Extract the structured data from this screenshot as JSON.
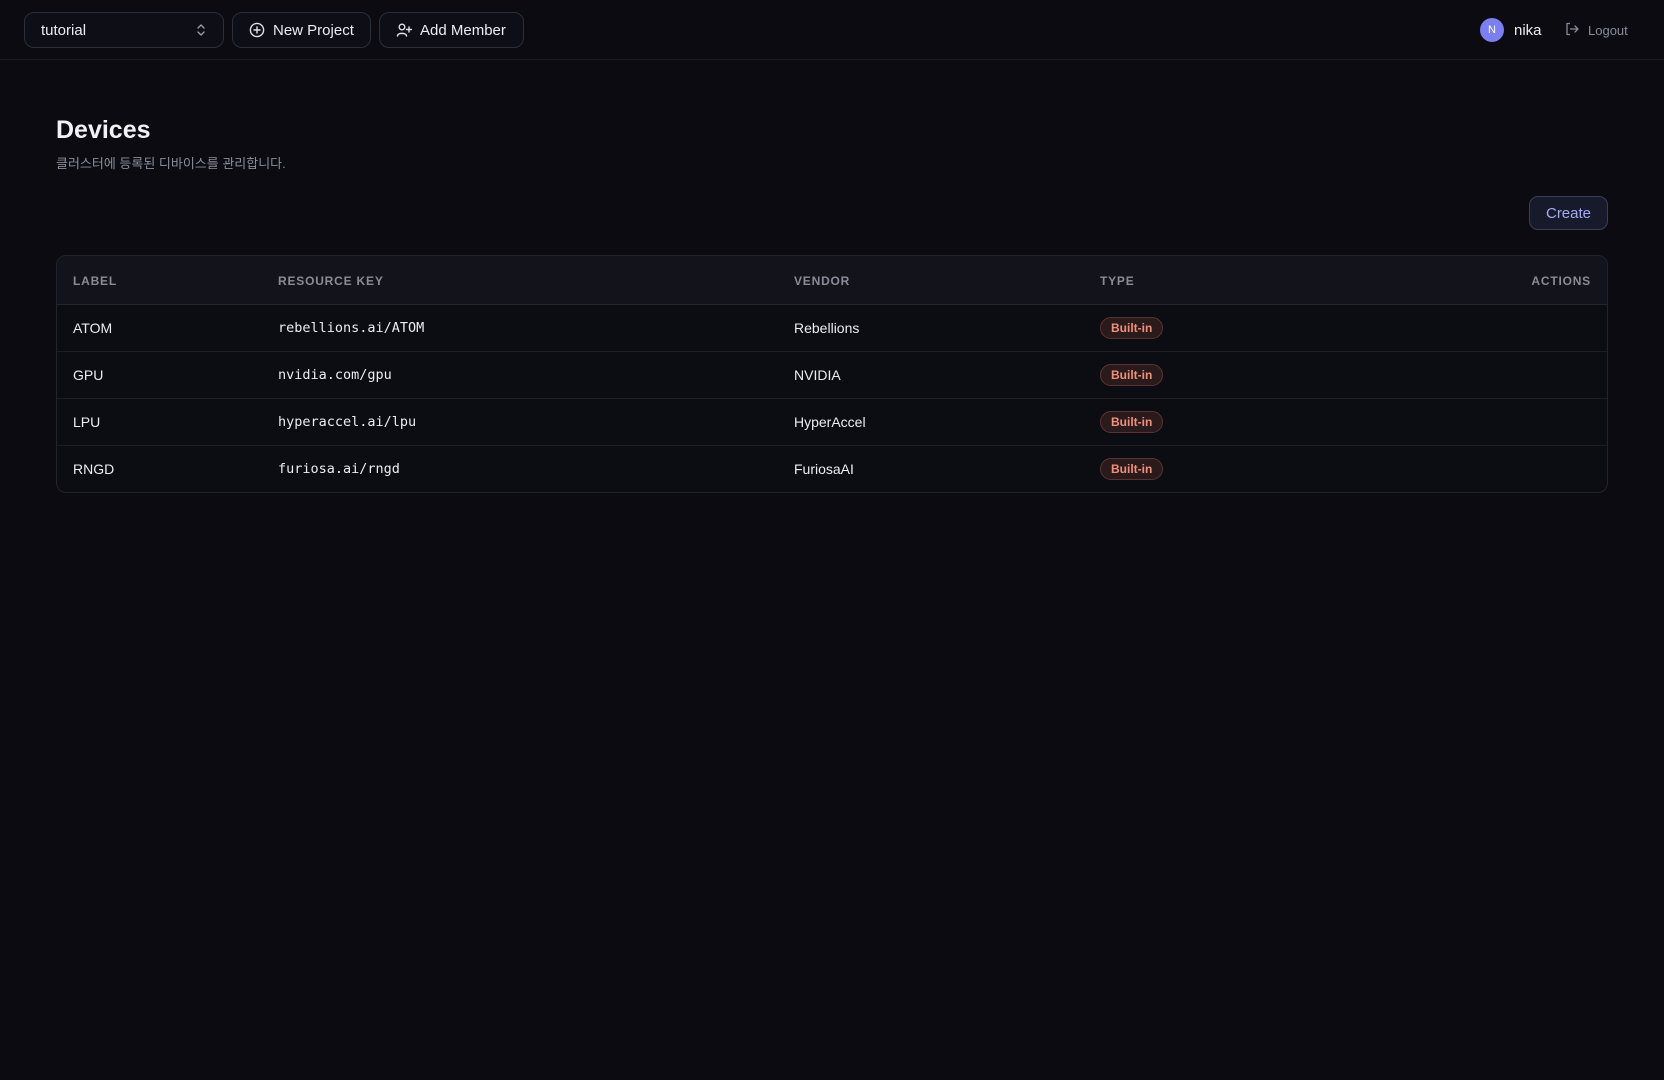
{
  "topbar": {
    "project_select": {
      "value": "tutorial",
      "icon": "chevron-up-down-icon"
    },
    "new_project_label": "New Project",
    "add_member_label": "Add Member",
    "user": {
      "initial": "N",
      "name": "nika",
      "avatar_color": "#7b7ff0"
    },
    "logout_label": "Logout"
  },
  "page": {
    "title": "Devices",
    "subtitle": "클러스터에 등록된 디바이스를 관리합니다.",
    "create_label": "Create"
  },
  "table": {
    "columns": {
      "label": "LABEL",
      "resource_key": "RESOURCE KEY",
      "vendor": "VENDOR",
      "type": "TYPE",
      "actions": "ACTIONS"
    },
    "rows": [
      {
        "label": "ATOM",
        "resource_key": "rebellions.ai/ATOM",
        "vendor": "Rebellions",
        "type": "Built-in"
      },
      {
        "label": "GPU",
        "resource_key": "nvidia.com/gpu",
        "vendor": "NVIDIA",
        "type": "Built-in"
      },
      {
        "label": "LPU",
        "resource_key": "hyperaccel.ai/lpu",
        "vendor": "HyperAccel",
        "type": "Built-in"
      },
      {
        "label": "RNGD",
        "resource_key": "furiosa.ai/rngd",
        "vendor": "FuriosaAI",
        "type": "Built-in"
      }
    ]
  },
  "colors": {
    "background": "#0b0b11",
    "accent": "#a4abf4",
    "badge_text": "#f0907a"
  }
}
